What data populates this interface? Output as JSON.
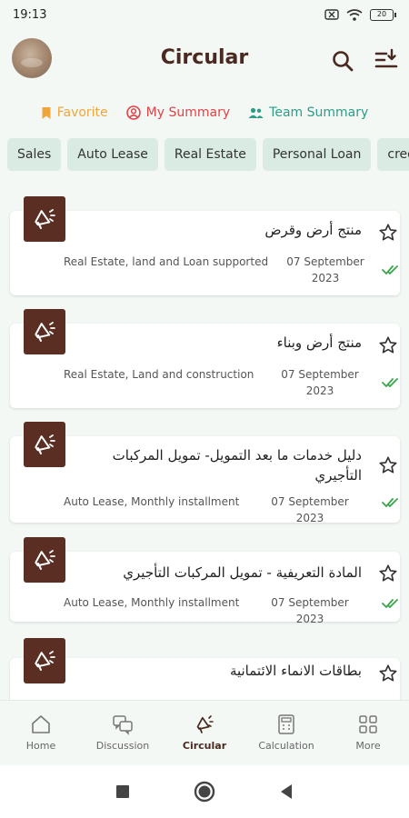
{
  "status": {
    "time": "19:13",
    "battery": "20"
  },
  "header": {
    "title": "Circular"
  },
  "filters": [
    {
      "label": "Favorite",
      "icon": "bookmark-icon",
      "color": "#f0a53a"
    },
    {
      "label": "My Summary",
      "icon": "user-circle-icon",
      "color": "#e0434a"
    },
    {
      "label": "Team Summary",
      "icon": "team-icon",
      "color": "#2e9c86"
    }
  ],
  "chips": [
    "Sales",
    "Auto Lease",
    "Real Estate",
    "Personal Loan",
    "cred"
  ],
  "circulars": [
    {
      "title": "منتج أرض وقرض",
      "tags": "Real Estate, land and Loan supported",
      "date": "07 September 2023"
    },
    {
      "title": "منتج أرض وبناء",
      "tags": "Real Estate, Land and construction",
      "date": "07 September 2023"
    },
    {
      "title": "دليل خدمات ما بعد التمويل- تمويل المركبات التأجيري",
      "tags": "Auto Lease, Monthly installment",
      "date": "07 September 2023"
    },
    {
      "title": "المادة التعريفية - تمويل المركبات التأجيري",
      "tags": "Auto Lease, Monthly installment",
      "date": "07 September 2023"
    },
    {
      "title": "بطاقات الانماء الائتمانية"
    }
  ],
  "nav": [
    "Home",
    "Discussion",
    "Circular",
    "Calculation",
    "More"
  ],
  "colors": {
    "brand": "#5a2e22",
    "chip_bg": "#d9ebe3",
    "check": "#3aa64a"
  }
}
